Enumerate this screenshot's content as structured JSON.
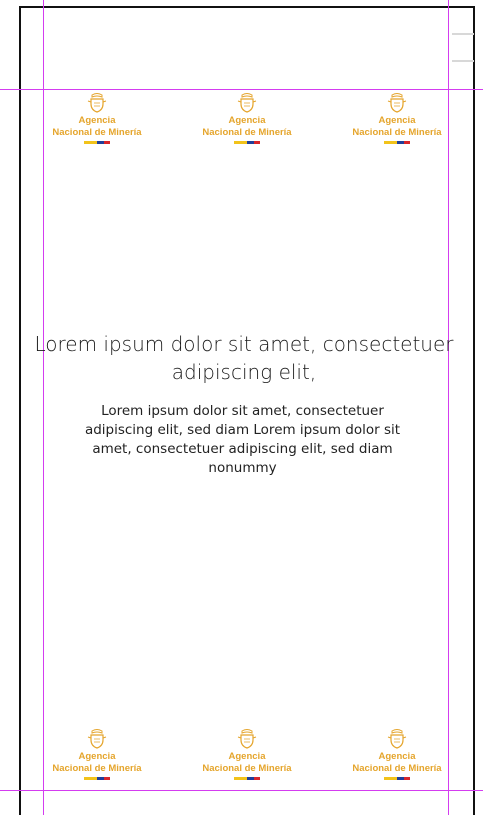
{
  "logo": {
    "line1": "Agencia",
    "line2": "Nacional de Minería",
    "icon": "coat-of-arms-icon",
    "color": "#e5a52c",
    "flag_colors": [
      "#f2c31a",
      "#1f3f9a",
      "#d8262a"
    ]
  },
  "content": {
    "headline": "Lorem ipsum dolor sit amet, consectetuer adipiscing elit,",
    "body": "Lorem ipsum dolor sit amet, consectetuer adipiscing elit, sed diam Lorem ipsum dolor sit amet, consectetuer adipiscing elit, sed diam nonummy"
  },
  "colors": {
    "guide": "#d43cf0",
    "frame": "#111111"
  }
}
